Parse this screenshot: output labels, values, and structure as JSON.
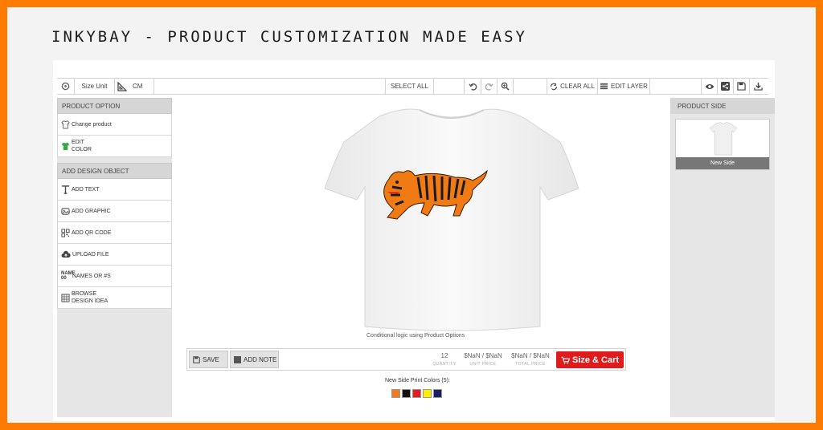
{
  "headline": "INKYBAY - PRODUCT CUSTOMIZATION MADE EASY",
  "toolbar": {
    "size_unit_label": "Size Unit",
    "unit_value": "CM",
    "select_all": "SELECT ALL",
    "clear_all": "CLEAR ALL",
    "edit_layer": "EDIT LAYER"
  },
  "left_sidebar": {
    "product_option_title": "PRODUCT OPTION",
    "product_items": [
      {
        "label": "Change product",
        "icon": "shirt-outline-icon"
      },
      {
        "label": "EDIT COLOR",
        "icon": "green-shirt-icon"
      }
    ],
    "design_title": "ADD DESIGN OBJECT",
    "design_items": [
      {
        "label": "ADD TEXT",
        "icon": "text-icon"
      },
      {
        "label": "ADD GRAPHIC",
        "icon": "graphic-icon"
      },
      {
        "label": "ADD QR CODE",
        "icon": "qr-code-icon"
      },
      {
        "label": "UPLOAD FILE",
        "icon": "upload-cloud-icon"
      },
      {
        "label": "NAMES OR #S",
        "icon": "names-numbers-icon"
      },
      {
        "label": "BROWSE DESIGN IDEA",
        "icon": "browse-grid-icon"
      }
    ],
    "names_icon_text": "NAME 00"
  },
  "canvas": {
    "caption": "Conditional logic using Product Options"
  },
  "bottom_bar": {
    "save": "SAVE",
    "add_note": "ADD NOTE",
    "quantity": "12",
    "quantity_label": "QUANTITY",
    "unit_price": "$NaN / $NaN",
    "unit_price_label": "UNIT PRICE",
    "total_price": "$NaN / $NaN",
    "total_price_label": "TOTAL PRICE",
    "cart": "Size & Cart"
  },
  "print_colors": {
    "label": "New Side Print Colors  (5):",
    "colors": [
      "#f47a20",
      "#111111",
      "#e02020",
      "#ffee00",
      "#1a2060"
    ]
  },
  "right_sidebar": {
    "title": "PRODUCT SIDE",
    "side_name": "New Side"
  }
}
